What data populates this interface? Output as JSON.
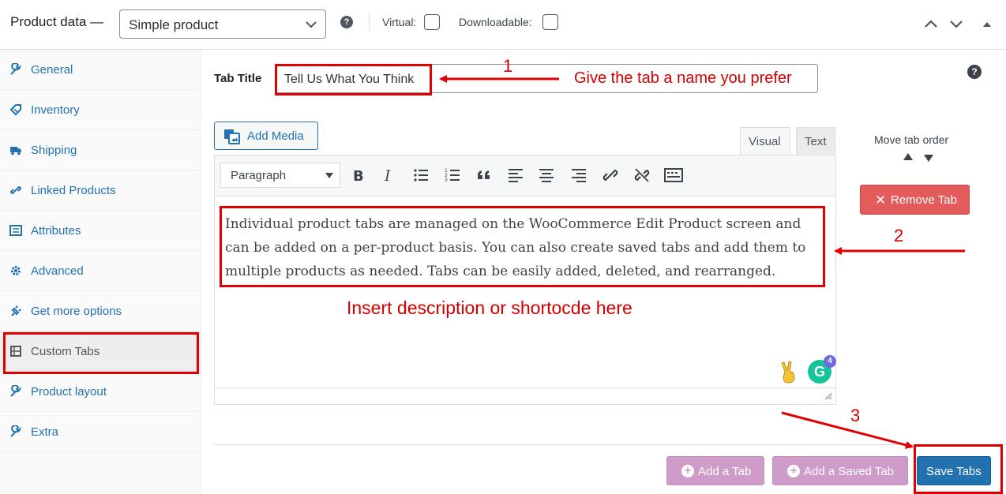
{
  "header": {
    "title": "Product data —",
    "product_type": "Simple product",
    "help": "?",
    "virtual_label": "Virtual:",
    "downloadable_label": "Downloadable:"
  },
  "sidebar": {
    "items": [
      {
        "label": "General",
        "icon": "wrench-icon"
      },
      {
        "label": "Inventory",
        "icon": "tag-icon"
      },
      {
        "label": "Shipping",
        "icon": "truck-icon"
      },
      {
        "label": "Linked Products",
        "icon": "link-icon"
      },
      {
        "label": "Attributes",
        "icon": "list-icon"
      },
      {
        "label": "Advanced",
        "icon": "gear-icon"
      },
      {
        "label": "Get more options",
        "icon": "plugin-icon"
      },
      {
        "label": "Custom Tabs",
        "icon": "tabs-icon"
      },
      {
        "label": "Product layout",
        "icon": "wrench-icon"
      },
      {
        "label": "Extra",
        "icon": "wrench-icon"
      }
    ],
    "active_index": 7
  },
  "tab_title": {
    "label": "Tab Title",
    "value": "Tell Us What You Think"
  },
  "editor": {
    "add_media": "Add Media",
    "visual_tab": "Visual",
    "text_tab": "Text",
    "format": "Paragraph",
    "content": "Individual product tabs are managed on the WooCommerce Edit Product screen and can be added on a per-product basis. You can also create saved tabs and add them to multiple products as needed. Tabs can be easily added, deleted, and rearranged.",
    "grammarly_letter": "G",
    "grammarly_count": "4"
  },
  "right": {
    "move_tab_order": "Move tab order",
    "remove_tab": "Remove Tab",
    "help": "?"
  },
  "footer": {
    "add_tab": "Add a Tab",
    "add_saved_tab": "Add a Saved Tab",
    "save_tabs": "Save Tabs"
  },
  "annotations": {
    "num1": "1",
    "text1": "Give the tab a name you prefer",
    "num2": "2",
    "text2": "Insert description or shortocde here",
    "num3": "3"
  },
  "colors": {
    "link": "#2271b1",
    "remove": "#e35b5b",
    "pink_button": "#cf9cca",
    "primary": "#2271b1",
    "annotation": "#e00000"
  }
}
